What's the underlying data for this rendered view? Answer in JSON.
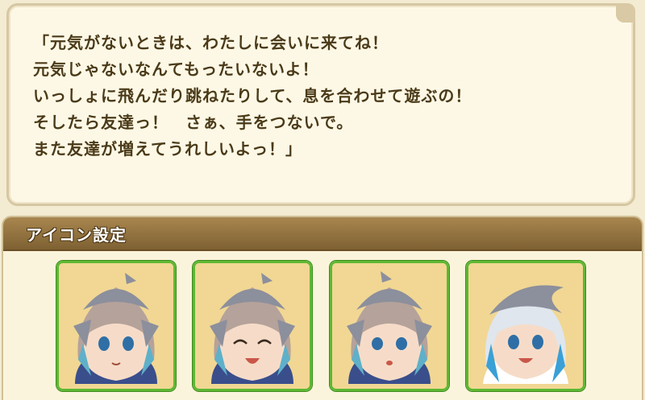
{
  "quote": {
    "lines": [
      "「元気がないときは、わたしに会いに来てね！",
      "元気じゃないなんてもったいないよ！",
      "いっしょに飛んだり跳ねたりして、息を合わせて遊ぶの！",
      "そしたら友達っ！　さぁ、手をつないで。",
      "また友達が増えてうれしいよっ！」"
    ]
  },
  "icon_settings": {
    "title": "アイコン設定",
    "icons": [
      {
        "name": "dolphin-girl-icon-neutral"
      },
      {
        "name": "dolphin-girl-icon-smile"
      },
      {
        "name": "dolphin-girl-icon-surprised"
      },
      {
        "name": "dolphin-girl-icon-cheerful"
      }
    ]
  },
  "colors": {
    "card_border": "#5fb834",
    "header_brown": "#8f7040",
    "text_brown": "#4a3a18"
  }
}
